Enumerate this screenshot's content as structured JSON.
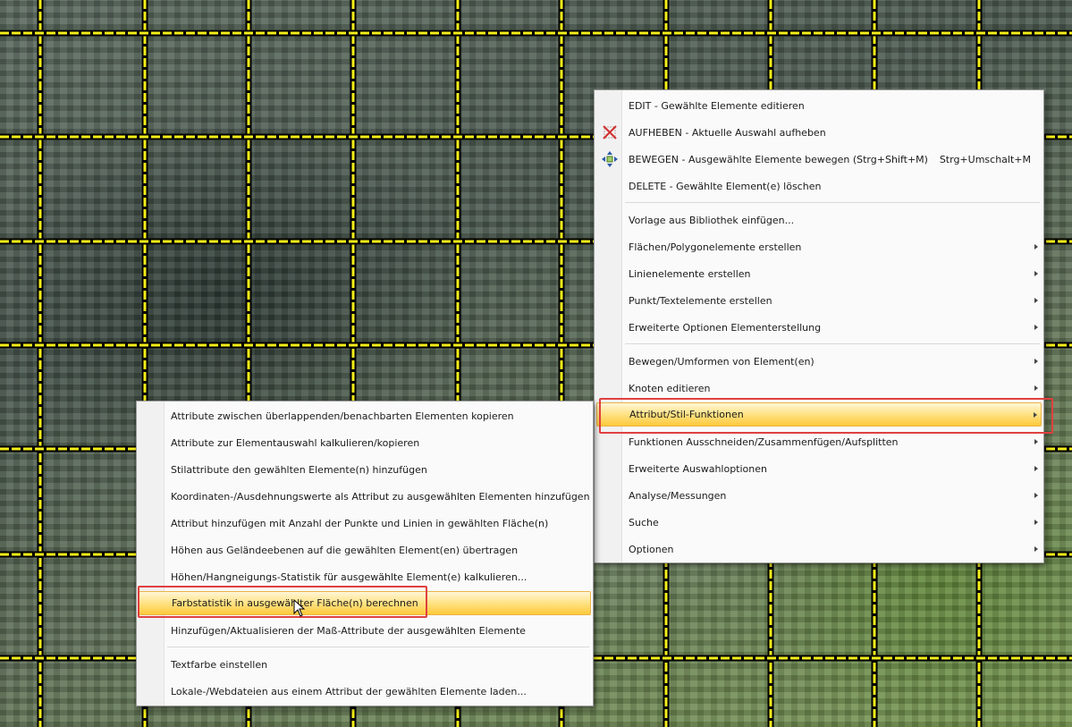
{
  "main_menu": {
    "items": [
      {
        "label": "EDIT - Gewählte Elemente editieren"
      },
      {
        "label": "AUFHEBEN - Aktuelle Auswahl aufheben",
        "icon": "clear-selection-icon"
      },
      {
        "label": "BEWEGEN - Ausgewählte Elemente bewegen (Strg+Shift+M)",
        "shortcut": "Strg+Umschalt+M",
        "icon": "move-icon"
      },
      {
        "label": "DELETE - Gewählte Element(e) löschen"
      },
      {
        "label": "Vorlage aus Bibliothek einfügen..."
      },
      {
        "label": "Flächen/Polygonelemente erstellen",
        "submenu": true
      },
      {
        "label": "Linienelemente erstellen",
        "submenu": true
      },
      {
        "label": "Punkt/Textelemente erstellen",
        "submenu": true
      },
      {
        "label": "Erweiterte Optionen Elementerstellung",
        "submenu": true
      },
      {
        "label": "Bewegen/Umformen von Element(en)",
        "submenu": true
      },
      {
        "label": "Knoten editieren",
        "submenu": true
      },
      {
        "label": "Attribut/Stil-Funktionen",
        "submenu": true,
        "highlighted": true
      },
      {
        "label": "Funktionen Ausschneiden/Zusammenfügen/Aufsplitten",
        "submenu": true
      },
      {
        "label": "Erweiterte Auswahloptionen",
        "submenu": true
      },
      {
        "label": "Analyse/Messungen",
        "submenu": true
      },
      {
        "label": "Suche",
        "submenu": true
      },
      {
        "label": "Optionen",
        "submenu": true
      }
    ]
  },
  "sub_menu": {
    "items": [
      {
        "label": "Attribute zwischen überlappenden/benachbarten Elementen kopieren"
      },
      {
        "label": "Attribute zur Elementauswahl kalkulieren/kopieren"
      },
      {
        "label": "Stilattribute den gewählten Elemente(n) hinzufügen"
      },
      {
        "label": "Koordinaten-/Ausdehnungswerte als Attribut zu ausgewählten Elementen hinzufügen"
      },
      {
        "label": "Attribut hinzufügen mit Anzahl der Punkte und Linien in gewählten Fläche(n)"
      },
      {
        "label": "Höhen aus Geländeebenen auf die gewählten Element(en) übertragen"
      },
      {
        "label": "Höhen/Hangneigungs-Statistik für ausgewählte Element(e) kalkulieren..."
      },
      {
        "label": "Farbstatistik in ausgewählter Fläche(n) berechnen",
        "highlighted": true
      },
      {
        "label": "Hinzufügen/Aktualisieren der Maß-Attribute der ausgewählten Elemente"
      },
      {
        "label": "Textfarbe einstellen"
      },
      {
        "label": "Lokale-/Webdateien aus einem Attribut der gewählten Elemente laden..."
      }
    ]
  },
  "colors": {
    "grid_yellow": "#f4ee1a",
    "highlight_box": "#e04040"
  }
}
